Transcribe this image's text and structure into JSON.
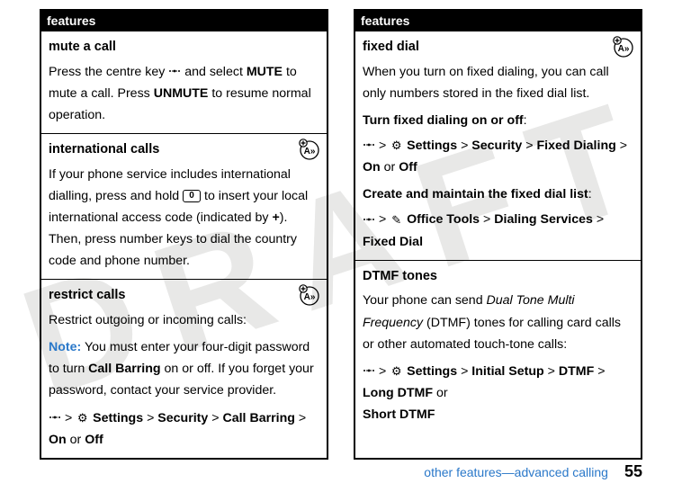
{
  "watermark": "DRAFT",
  "left": {
    "header": "features",
    "sections": [
      {
        "title": "mute a call",
        "body_before": "Press the centre key ",
        "body_mid1": " and select ",
        "mute": "MUTE",
        "body_mid2": " to mute a call. Press ",
        "unmute": "UNMUTE",
        "body_after": " to resume normal operation."
      },
      {
        "title": "international calls",
        "body1": "If your phone service includes international dialling, press and hold ",
        "zero": "0",
        "body2": " to insert your local international access code (indicated by ",
        "plus": "+",
        "body3": "). Then, press number keys to dial the country code and phone number."
      },
      {
        "title": "restrict calls",
        "line1": "Restrict outgoing or incoming calls:",
        "note_label": "Note:",
        "note_text": " You must enter your four-digit password to turn ",
        "callbarring": "Call Barring",
        "note_text2": " on or off. If you forget your password, contact your service provider.",
        "path_settings": "Settings",
        "path_security": "Security",
        "path_cb": "Call Barring",
        "path_on": "On",
        "or": " or ",
        "path_off": "Off"
      }
    ]
  },
  "right": {
    "header": "features",
    "sections": [
      {
        "title": "fixed dial",
        "line1": "When you turn on fixed dialing, you can call only numbers stored in the fixed dial list.",
        "sub1": "Turn fixed dialing on or off",
        "colon": ":",
        "path_settings": "Settings",
        "path_security": "Security",
        "path_fd": "Fixed Dialing",
        "path_on": "On",
        "or": " or ",
        "path_off": "Off",
        "sub2": "Create and maintain the fixed dial list",
        "path_tools": "Office Tools",
        "path_ds": "Dialing Services",
        "path_fdial": "Fixed Dial"
      },
      {
        "title": "DTMF tones",
        "line1a": "Your phone can send ",
        "italic": "Dual Tone Multi Frequency",
        "line1b": " (DTMF) tones for calling card calls or other automated touch-tone calls:",
        "path_settings": "Settings",
        "path_init": "Initial Setup",
        "path_dtmf": "DTMF",
        "path_long": "Long DTMF",
        "or": " or ",
        "path_short": "Short DTMF"
      }
    ]
  },
  "footer": {
    "text": "other features—advanced calling",
    "page": "55"
  }
}
